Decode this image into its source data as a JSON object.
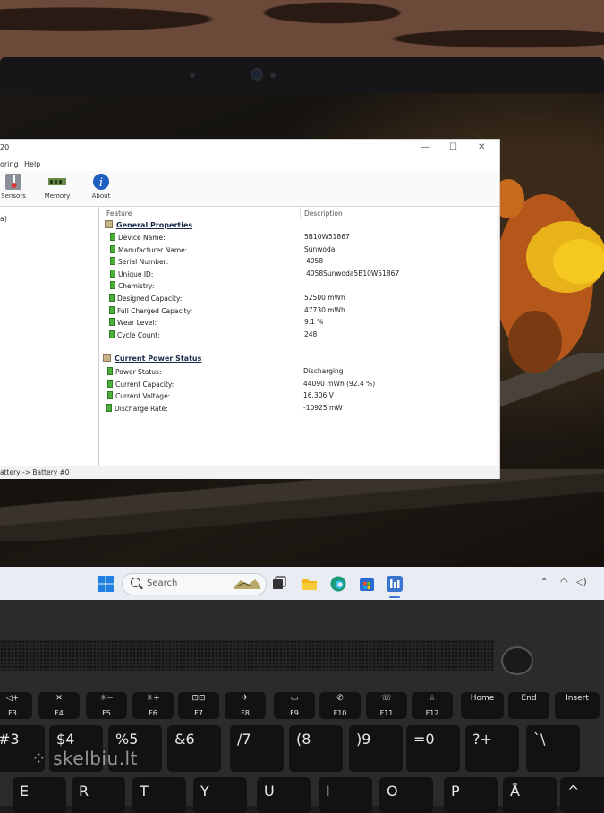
{
  "window": {
    "title_fragment": "20",
    "menu": [
      "oring",
      "Help"
    ],
    "toolbar": [
      {
        "label": "Sensors",
        "icon": "thermometer-icon"
      },
      {
        "label": "Memory",
        "icon": "memory-chip-icon"
      },
      {
        "label": "About",
        "icon": "info-icon"
      }
    ],
    "left_pane_item": "a)",
    "columns": {
      "feature": "Feature",
      "description": "Description"
    },
    "general": {
      "heading": "General Properties",
      "rows": [
        {
          "feature": "Device Name:",
          "value": "5B10W51867"
        },
        {
          "feature": "Manufacturer Name:",
          "value": "Sunwoda"
        },
        {
          "feature": "Serial Number:",
          "value": "4058"
        },
        {
          "feature": "Unique ID:",
          "value": "4058Sunwoda5B10W51867"
        },
        {
          "feature": "Chemistry:",
          "value": ""
        },
        {
          "feature": "Designed Capacity:",
          "value": "52500 mWh"
        },
        {
          "feature": "Full Charged Capacity:",
          "value": "47730 mWh"
        },
        {
          "feature": "Wear Level:",
          "value": "9.1 %"
        },
        {
          "feature": "Cycle Count:",
          "value": "248"
        }
      ]
    },
    "power": {
      "heading": "Current Power Status",
      "rows": [
        {
          "feature": "Power Status:",
          "value": "Discharging"
        },
        {
          "feature": "Current Capacity:",
          "value": "44090 mWh (92.4 %)"
        },
        {
          "feature": "Current Voltage:",
          "value": "16.306 V"
        },
        {
          "feature": "Discharge Rate:",
          "value": "-10925 mW"
        }
      ]
    },
    "statusbar": "attery -> Battery #0"
  },
  "taskbar": {
    "search_placeholder": "Search",
    "apps": [
      "windows-start-icon",
      "task-view-icon",
      "file-explorer-icon",
      "edge-icon",
      "store-icon",
      "battery-app-icon"
    ],
    "tray": [
      "chevron-up-icon",
      "wifi-icon",
      "volume-icon"
    ]
  },
  "keyboard": {
    "fn_row": [
      {
        "top": "◁+",
        "bottom": "F3"
      },
      {
        "top": "✕",
        "bottom": "F4"
      },
      {
        "top": "☼−",
        "bottom": "F5"
      },
      {
        "top": "☼+",
        "bottom": "F6"
      },
      {
        "top": "⊡⊡",
        "bottom": "F7"
      },
      {
        "top": "✈",
        "bottom": "F8"
      },
      {
        "top": "▭",
        "bottom": "F9"
      },
      {
        "top": "✆",
        "bottom": "F10"
      },
      {
        "top": "☏",
        "bottom": "F11"
      },
      {
        "top": "☆",
        "bottom": "F12"
      },
      {
        "top": "Home",
        "bottom": ""
      },
      {
        "top": "End",
        "bottom": ""
      },
      {
        "top": "Insert",
        "bottom": ""
      }
    ],
    "num_row": [
      "#3",
      "$4",
      "%5",
      "&6",
      "/7",
      "(8",
      ")9",
      "=0",
      "?+",
      "`\\"
    ],
    "letter_row": [
      "E",
      "R",
      "T",
      "Y",
      "U",
      "I",
      "O",
      "P",
      "Å",
      "^"
    ]
  },
  "watermark": "skelbiu.lt"
}
